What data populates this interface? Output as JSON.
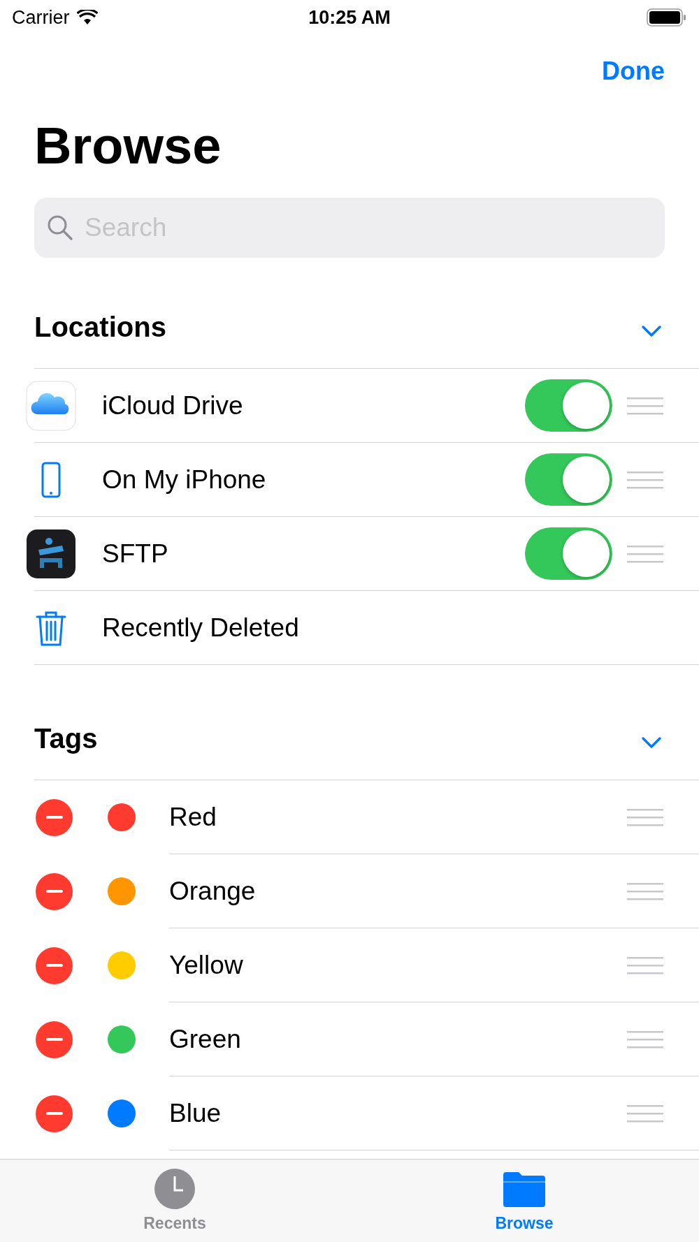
{
  "status_bar": {
    "carrier": "Carrier",
    "time": "10:25 AM"
  },
  "nav": {
    "done": "Done",
    "title": "Browse"
  },
  "search": {
    "placeholder": "Search"
  },
  "locations": {
    "title": "Locations",
    "expanded": true,
    "items": [
      {
        "kind": "toggle",
        "label": "iCloud Drive",
        "on": true
      },
      {
        "kind": "toggle",
        "label": "On My iPhone",
        "on": true
      },
      {
        "kind": "toggle",
        "label": "SFTP",
        "on": true
      },
      {
        "kind": "plain",
        "label": "Recently Deleted"
      }
    ]
  },
  "tags": {
    "title": "Tags",
    "expanded": true,
    "items": [
      {
        "label": "Red",
        "color": "#ff3b30"
      },
      {
        "label": "Orange",
        "color": "#ff9500"
      },
      {
        "label": "Yellow",
        "color": "#ffcc00"
      },
      {
        "label": "Green",
        "color": "#34c759"
      },
      {
        "label": "Blue",
        "color": "#007aff"
      }
    ]
  },
  "tab_bar": [
    {
      "kind": "clock",
      "label": "Recents",
      "selected": false
    },
    {
      "kind": "folder",
      "label": "Browse",
      "selected": true
    }
  ]
}
